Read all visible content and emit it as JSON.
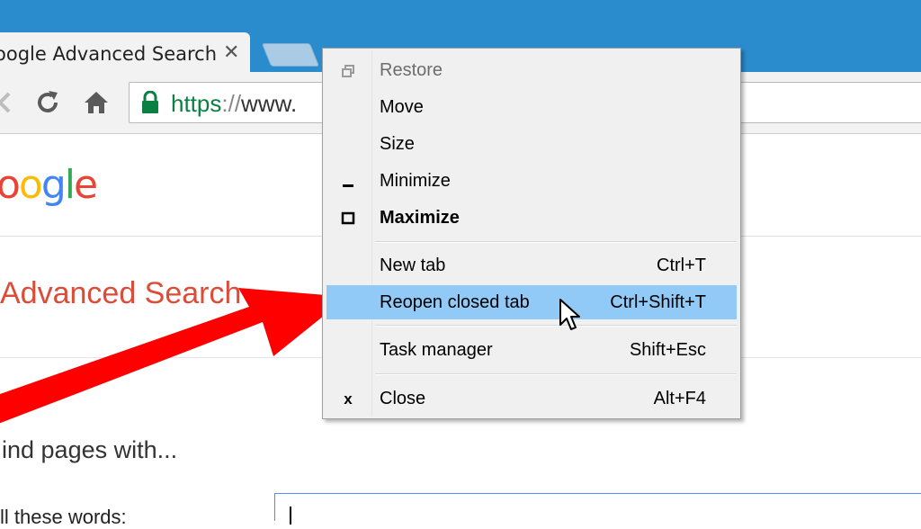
{
  "browser": {
    "tab_title": "oogle Advanced Search",
    "tab_close": "✕",
    "url_scheme": "https",
    "url_sep": "://",
    "url_host": "www.",
    "colors": {
      "titlebar": "#2b8ccd",
      "secure": "#0b8043"
    },
    "icons": [
      "back-icon",
      "reload-icon",
      "home-icon",
      "lock-icon"
    ]
  },
  "page": {
    "logo_letters": [
      "o",
      "o",
      "g",
      "l",
      "e"
    ],
    "title": "Advanced Search",
    "find_heading": "ind pages with...",
    "words_label": "ll these words:"
  },
  "menu": {
    "items": [
      {
        "label": "Restore",
        "shortcut": "",
        "icon": "restore-icon",
        "state": "disabled"
      },
      {
        "label": "Move",
        "shortcut": "",
        "icon": "",
        "state": "normal"
      },
      {
        "label": "Size",
        "shortcut": "",
        "icon": "",
        "state": "normal"
      },
      {
        "label": "Minimize",
        "shortcut": "",
        "icon": "minimize-icon",
        "state": "normal"
      },
      {
        "label": "Maximize",
        "shortcut": "",
        "icon": "maximize-icon",
        "state": "bold"
      },
      {
        "label": "New tab",
        "shortcut": "Ctrl+T",
        "icon": "",
        "state": "normal"
      },
      {
        "label": "Reopen closed tab",
        "shortcut": "Ctrl+Shift+T",
        "icon": "",
        "state": "highlighted"
      },
      {
        "label": "Task manager",
        "shortcut": "Shift+Esc",
        "icon": "",
        "state": "normal"
      },
      {
        "label": "Close",
        "shortcut": "Alt+F4",
        "icon": "close-icon",
        "state": "normal"
      }
    ],
    "close_glyph": "x",
    "highlight_color": "#91c9f7"
  },
  "annotation": {
    "arrow_color": "#ff0000"
  }
}
